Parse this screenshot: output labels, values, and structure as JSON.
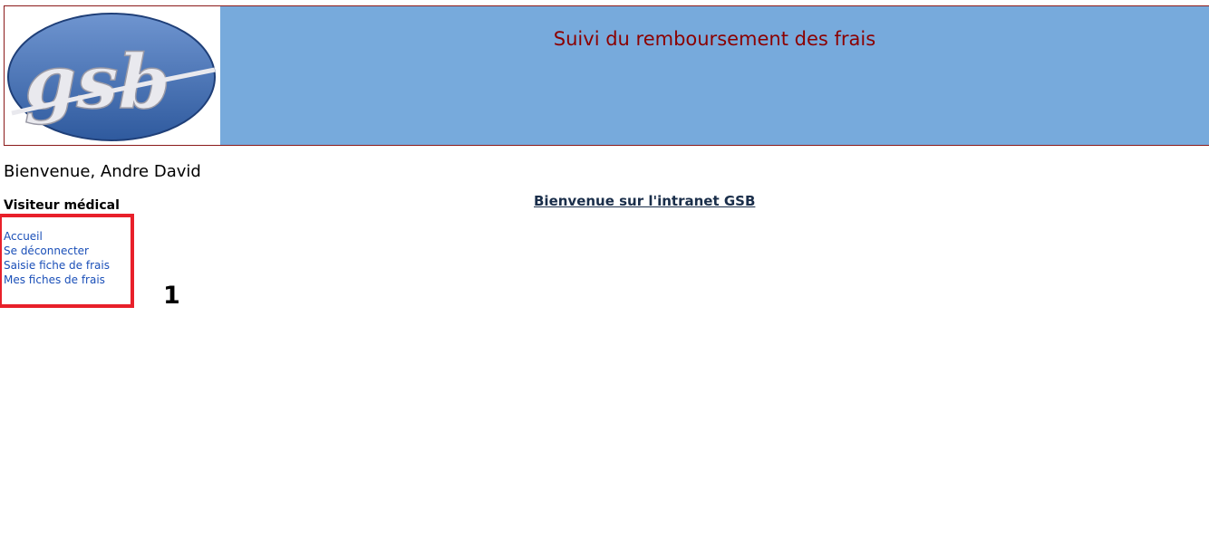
{
  "header": {
    "logo_text": "gsb",
    "title": "Suivi du remboursement des frais"
  },
  "user": {
    "welcome": "Bienvenue, Andre David",
    "role": "Visiteur médical"
  },
  "menu": {
    "items": [
      {
        "label": "Accueil"
      },
      {
        "label": "Se déconnecter"
      },
      {
        "label": "Saisie fiche de frais"
      },
      {
        "label": "Mes fiches de frais"
      }
    ]
  },
  "main": {
    "welcome_link": "Bienvenue sur l'intranet GSB"
  },
  "annotation": {
    "number": "1",
    "color": "#e8202a"
  },
  "colors": {
    "header_bg": "#77aadc",
    "title": "#8b0000",
    "link": "#1a4fb8"
  }
}
